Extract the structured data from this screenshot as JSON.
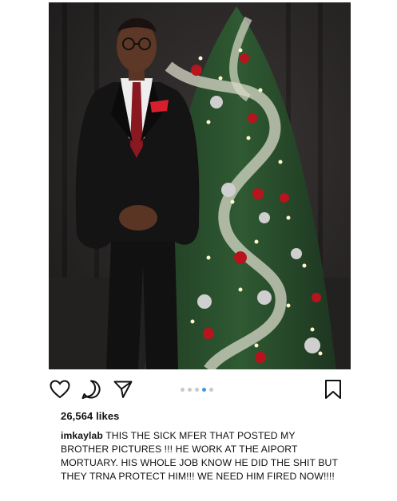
{
  "post": {
    "photo_alt": "",
    "carousel": {
      "count": 5,
      "active_index": 3
    },
    "likes_text": "26,564 likes",
    "caption": {
      "username": "imkaylab",
      "text": "THIS THE SICK MFER THAT POSTED MY BROTHER PICTURES !!! HE WORK AT THE AIPORT MORTUARY. HIS WHOLE JOB KNOW HE DID THE SHIT BUT THEY TRNA PROTECT HIM!!! WE NEED HIM FIRED NOW!!!!"
    }
  },
  "icons": {
    "like": "heart-icon",
    "comment": "comment-icon",
    "share": "paper-plane-icon",
    "save": "bookmark-icon"
  },
  "colors": {
    "dot_active": "#3897f0",
    "dot_inactive": "#c9c9c9",
    "text": "#111111"
  }
}
